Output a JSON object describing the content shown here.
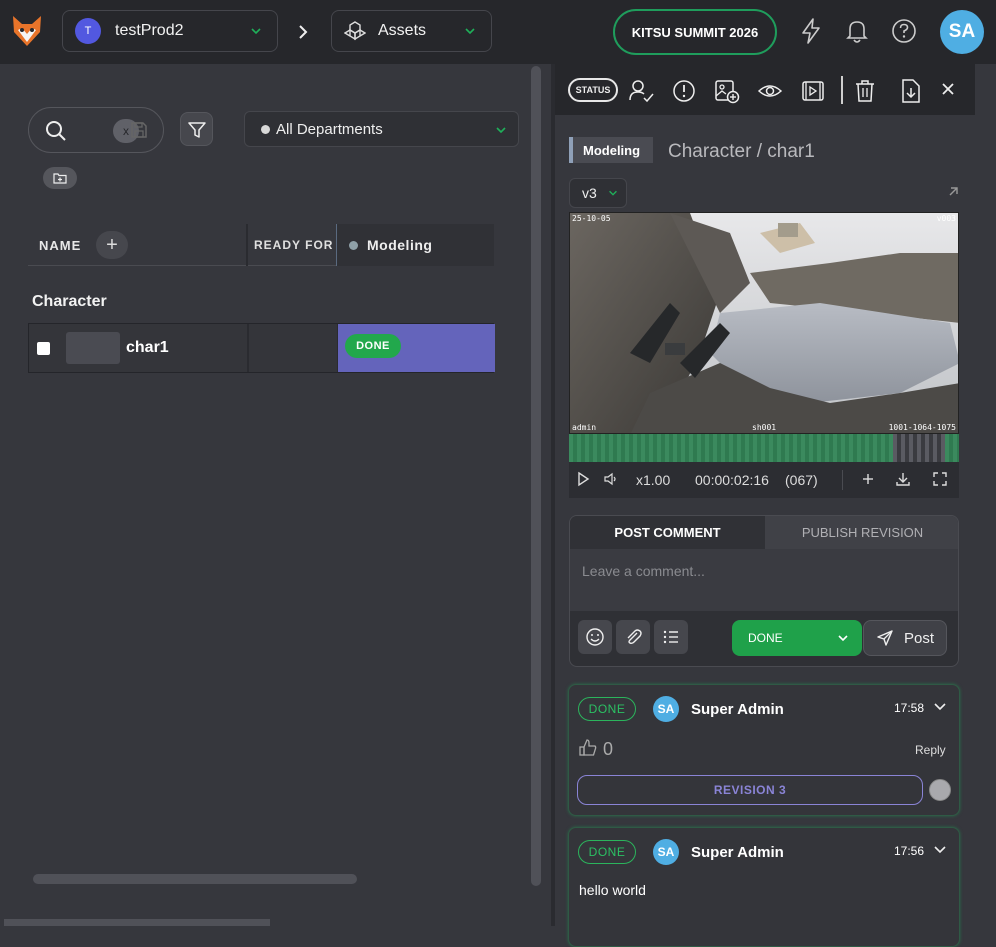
{
  "topbar": {
    "production": {
      "initial": "T",
      "name": "testProd2"
    },
    "section": "Assets",
    "summit_label": "KITSU SUMMIT 2026",
    "user_initials": "SA",
    "brand_color": "#1f9d5c",
    "icons": [
      "kitsu-logo-icon",
      "chevron-down-icon",
      "chevron-right-icon",
      "assets-cube-icon",
      "lightning-icon",
      "bell-icon",
      "help-icon"
    ]
  },
  "filters": {
    "search_clear_label": "x",
    "department": "All Departments"
  },
  "table": {
    "col_name": "NAME",
    "col_ready_for": "READY FOR",
    "col_task": "Modeling",
    "group": "Character",
    "rows": [
      {
        "name": "char1",
        "status": "DONE",
        "status_color": "#22a84c",
        "cell_color": "#6464bb"
      }
    ]
  },
  "panel": {
    "status_label": "STATUS",
    "task_type": "Modeling",
    "title": "Character / char1",
    "version": "v3",
    "preview": {
      "top_left": "25-10-05",
      "top_right": "v003",
      "bottom_left": "admin",
      "bottom_center": "sh001",
      "bottom_right": "1001-1064-1075"
    },
    "player": {
      "speed": "x1.00",
      "timecode": "00:00:02:16",
      "frame": "(067)"
    },
    "comment_form": {
      "tab_post": "POST COMMENT",
      "tab_publish": "PUBLISH REVISION",
      "placeholder": "Leave a comment...",
      "status": "DONE",
      "post_label": "Post"
    },
    "comments": [
      {
        "status": "DONE",
        "initials": "SA",
        "author": "Super Admin",
        "time": "17:58",
        "likes": "0",
        "reply_label": "Reply",
        "revision": "REVISION 3"
      },
      {
        "status": "DONE",
        "initials": "SA",
        "author": "Super Admin",
        "time": "17:56",
        "text": "hello world"
      }
    ]
  }
}
